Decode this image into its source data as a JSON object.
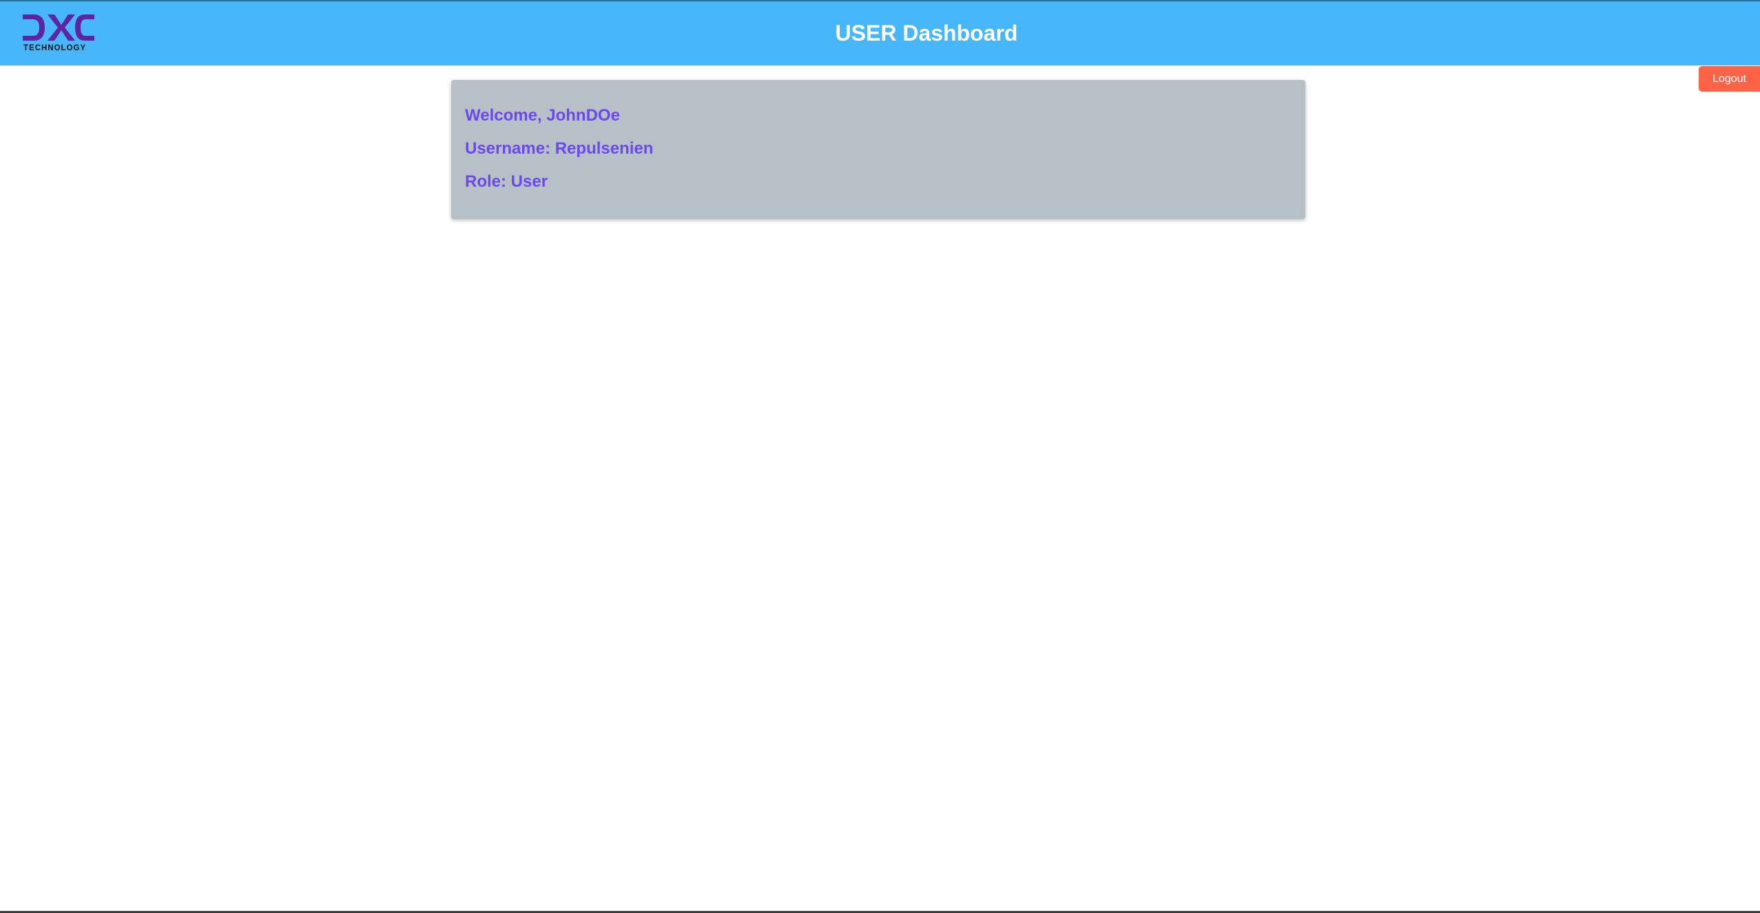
{
  "header": {
    "title": "USER Dashboard",
    "logo": {
      "icon": "dxc-logo-icon",
      "wordmark": "TECHNOLOGY",
      "brand_color": "#5f259f"
    },
    "background_color": "#48b6fb"
  },
  "actions": {
    "logout_label": "Logout",
    "logout_color": "#ff6347"
  },
  "user_card": {
    "welcome": "Welcome, JohnDOe",
    "username": "Username: Repulsenien",
    "role": "Role: User",
    "text_color": "#6b48f0",
    "background_color": "#b7bfc7"
  }
}
